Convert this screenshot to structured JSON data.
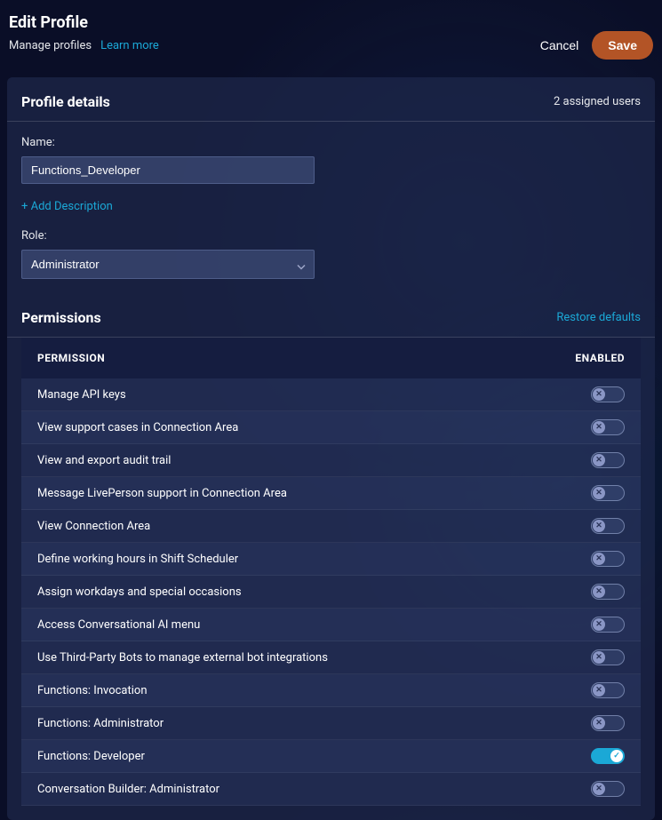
{
  "header": {
    "title": "Edit Profile",
    "manage_profiles": "Manage profiles",
    "learn_more": "Learn more",
    "cancel": "Cancel",
    "save": "Save"
  },
  "profile_details": {
    "title": "Profile details",
    "assigned_users": "2 assigned users",
    "name_label": "Name:",
    "name_value": "Functions_Developer",
    "add_description": "+ Add Description",
    "role_label": "Role:",
    "role_value": "Administrator"
  },
  "permissions": {
    "title": "Permissions",
    "restore_defaults": "Restore defaults",
    "col_permission": "PERMISSION",
    "col_enabled": "ENABLED",
    "rows": [
      {
        "label": "Manage API keys",
        "enabled": false
      },
      {
        "label": "View support cases in Connection Area",
        "enabled": false
      },
      {
        "label": "View and export audit trail",
        "enabled": false
      },
      {
        "label": "Message LivePerson support in Connection Area",
        "enabled": false
      },
      {
        "label": "View Connection Area",
        "enabled": false
      },
      {
        "label": "Define working hours in Shift Scheduler",
        "enabled": false
      },
      {
        "label": "Assign workdays and special occasions",
        "enabled": false
      },
      {
        "label": "Access Conversational AI menu",
        "enabled": false
      },
      {
        "label": "Use Third-Party Bots to manage external bot integrations",
        "enabled": false
      },
      {
        "label": "Functions: Invocation",
        "enabled": false
      },
      {
        "label": "Functions: Administrator",
        "enabled": false
      },
      {
        "label": "Functions: Developer",
        "enabled": true
      },
      {
        "label": "Conversation Builder: Administrator",
        "enabled": false
      }
    ]
  }
}
